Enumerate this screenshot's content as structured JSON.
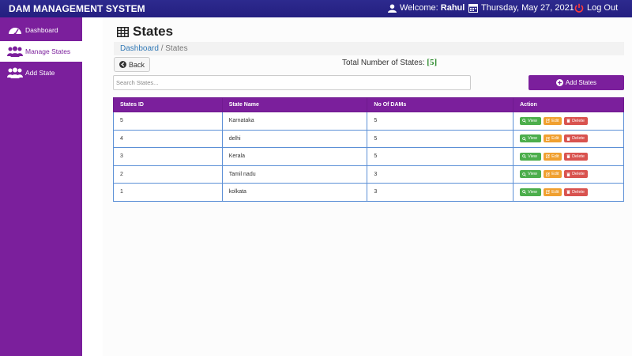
{
  "header": {
    "brand": "DAM MANAGEMENT SYSTEM",
    "welcome_prefix": "Welcome: ",
    "user": "Rahul",
    "date": "Thursday, May 27, 2021",
    "logout": "Log Out"
  },
  "sidebar": {
    "items": [
      {
        "label": "Dashboard",
        "icon": "dashboard-icon"
      },
      {
        "label": "Manage States",
        "icon": "users-icon",
        "active": true
      },
      {
        "label": "Add State",
        "icon": "users-icon"
      }
    ]
  },
  "page": {
    "title": "States",
    "breadcrumb_link": "Dashboard",
    "breadcrumb_sep": " / ",
    "breadcrumb_current": "States",
    "back_label": "Back",
    "total_label": "Total Number of States: ",
    "total_value": "[5]",
    "search_placeholder": "Search States...",
    "add_label": "Add States"
  },
  "table": {
    "columns": [
      "States ID",
      "State Name",
      "No Of DAMs",
      "Action"
    ],
    "rows": [
      {
        "id": "5",
        "name": "Karnataka",
        "dams": "5"
      },
      {
        "id": "4",
        "name": "delhi",
        "dams": "5"
      },
      {
        "id": "3",
        "name": "Kerala",
        "dams": "5"
      },
      {
        "id": "2",
        "name": "Tamil nadu",
        "dams": "3"
      },
      {
        "id": "1",
        "name": "kolkata",
        "dams": "3"
      }
    ],
    "actions": {
      "view": "View",
      "edit": "Edit",
      "delete": "Delete"
    }
  },
  "colors": {
    "topbar": "#2d2a8e",
    "sidebar": "#7b1f9c",
    "accent": "#7b1f9c",
    "view": "#4cae4c",
    "edit": "#f0a030",
    "delete": "#d9534f"
  }
}
